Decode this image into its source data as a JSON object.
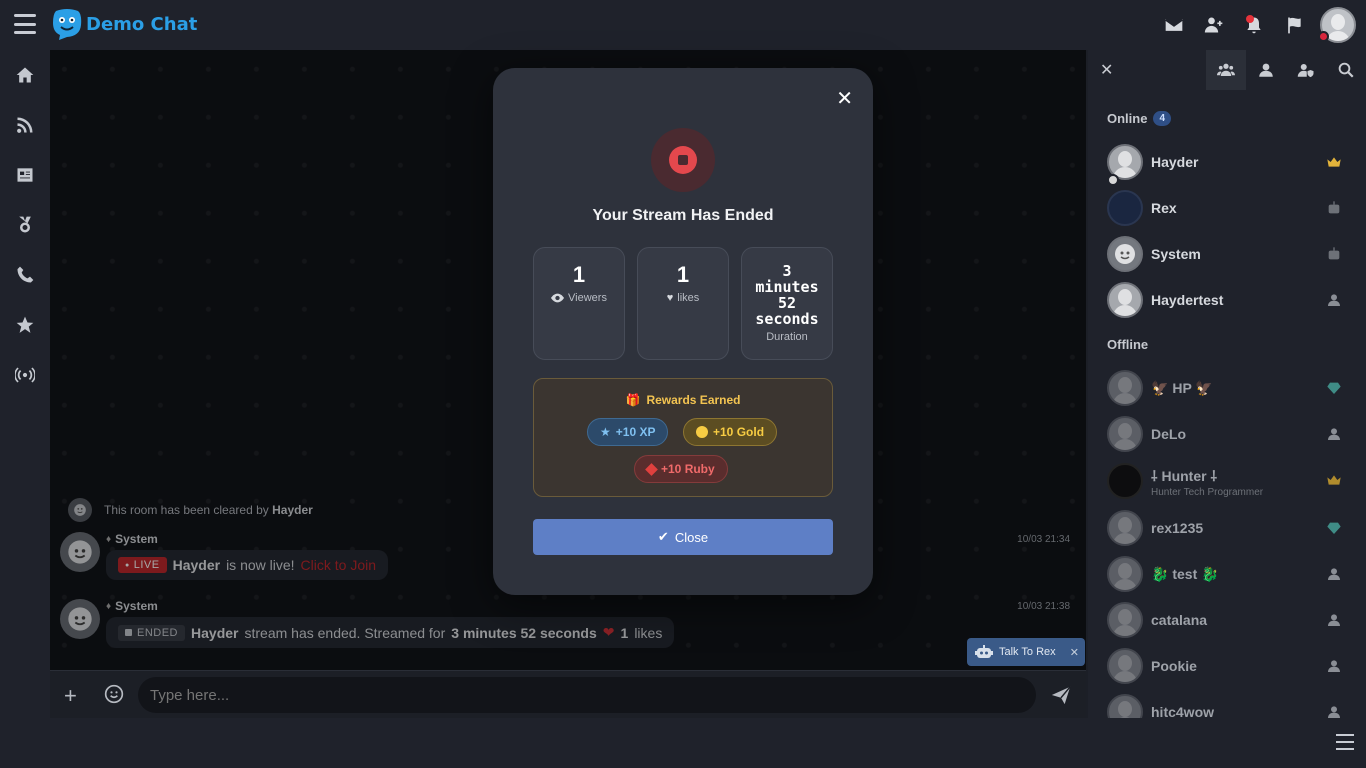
{
  "app": {
    "name": "Demo Chat"
  },
  "chat": {
    "cleared_text": "This room has been cleared by",
    "cleared_by": "Hayder",
    "messages": [
      {
        "sender": "System",
        "live_label": "LIVE",
        "user": "Hayder",
        "text": "is now live!",
        "join": "Click to Join",
        "time": "10/03 21:34"
      },
      {
        "sender": "System",
        "ended_label": "ENDED",
        "user": "Hayder",
        "text": "stream has ended. Streamed for",
        "duration": "3 minutes 52 seconds",
        "likes": "1",
        "likes_suffix": "likes",
        "time": "10/03 21:38"
      }
    ],
    "talk_rex": "Talk To Rex",
    "input_placeholder": "Type here..."
  },
  "modal": {
    "title": "Your Stream Has Ended",
    "viewers": {
      "value": "1",
      "label": "Viewers"
    },
    "likes": {
      "value": "1",
      "label": "likes"
    },
    "duration": {
      "line1": "3",
      "line2": "minutes",
      "line3": "52",
      "line4": "seconds",
      "label": "Duration"
    },
    "rewards_title": "Rewards Earned",
    "xp": "+10 XP",
    "gold": "+10 Gold",
    "ruby": "+10 Ruby",
    "close_label": "Close"
  },
  "users": {
    "online_label": "Online",
    "online_count": "4",
    "offline_label": "Offline",
    "online": [
      {
        "name": "Hayder",
        "badge": "crown-icon"
      },
      {
        "name": "Rex",
        "badge": "bot-icon"
      },
      {
        "name": "System",
        "badge": "bot-icon"
      },
      {
        "name": "Haydertest",
        "badge": "user-icon"
      }
    ],
    "offline": [
      {
        "name": "HP",
        "badge": "diamond-icon"
      },
      {
        "name": "DeLo",
        "badge": "user-icon"
      },
      {
        "name": "Hunter",
        "sub": "Hunter Tech Programmer",
        "badge": "crown-icon"
      },
      {
        "name": "rex1235",
        "badge": "diamond-icon"
      },
      {
        "name": "test",
        "badge": "user-icon"
      },
      {
        "name": "catalana",
        "badge": "user-icon"
      },
      {
        "name": "Pookie",
        "badge": "user-icon"
      },
      {
        "name": "hitc4wow",
        "badge": "user-icon"
      }
    ]
  },
  "colors": {
    "accent": "#5e7fc6",
    "live": "#c0282d",
    "gold": "#f3c451",
    "brand": "#2b9fe6"
  }
}
